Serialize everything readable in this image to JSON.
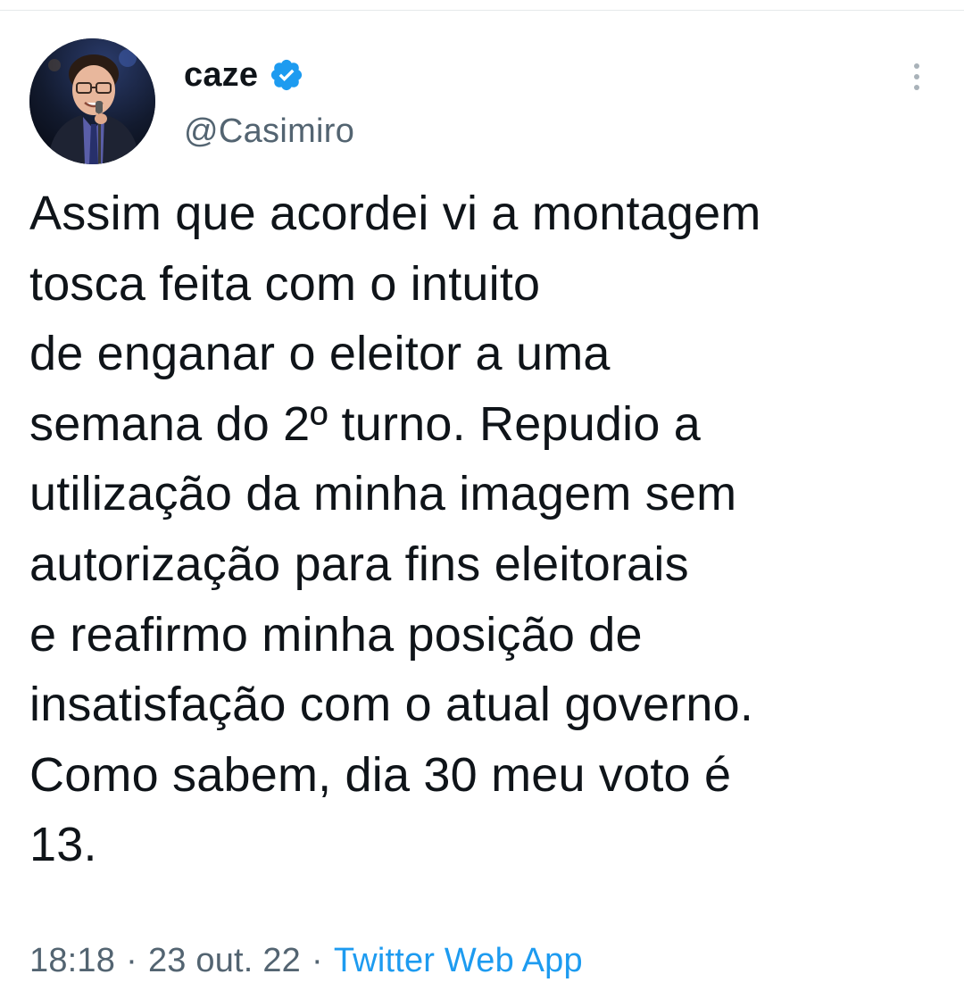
{
  "tweet": {
    "author": {
      "display_name": "caze",
      "handle": "@Casimiro",
      "verified": true
    },
    "text": "Assim que acordei vi a montagem\ntosca feita com o intuito\nde enganar o eleitor a uma\nsemana do 2º turno. Repudio a\nutilização da minha imagem sem\nautorização para fins eleitorais\ne reafirmo minha posição de\ninsatisfação com o atual governo.\nComo sabem, dia 30 meu voto é\n13.",
    "time": "18:18",
    "separator": "·",
    "date": "23 out. 22",
    "source": "Twitter Web App"
  },
  "icons": {
    "verified": "verified-badge-icon",
    "more": "more-options-icon"
  },
  "colors": {
    "text": "#0f1419",
    "secondary": "#536471",
    "accent": "#1d9bf0",
    "more_dots": "#a9b2b9"
  }
}
